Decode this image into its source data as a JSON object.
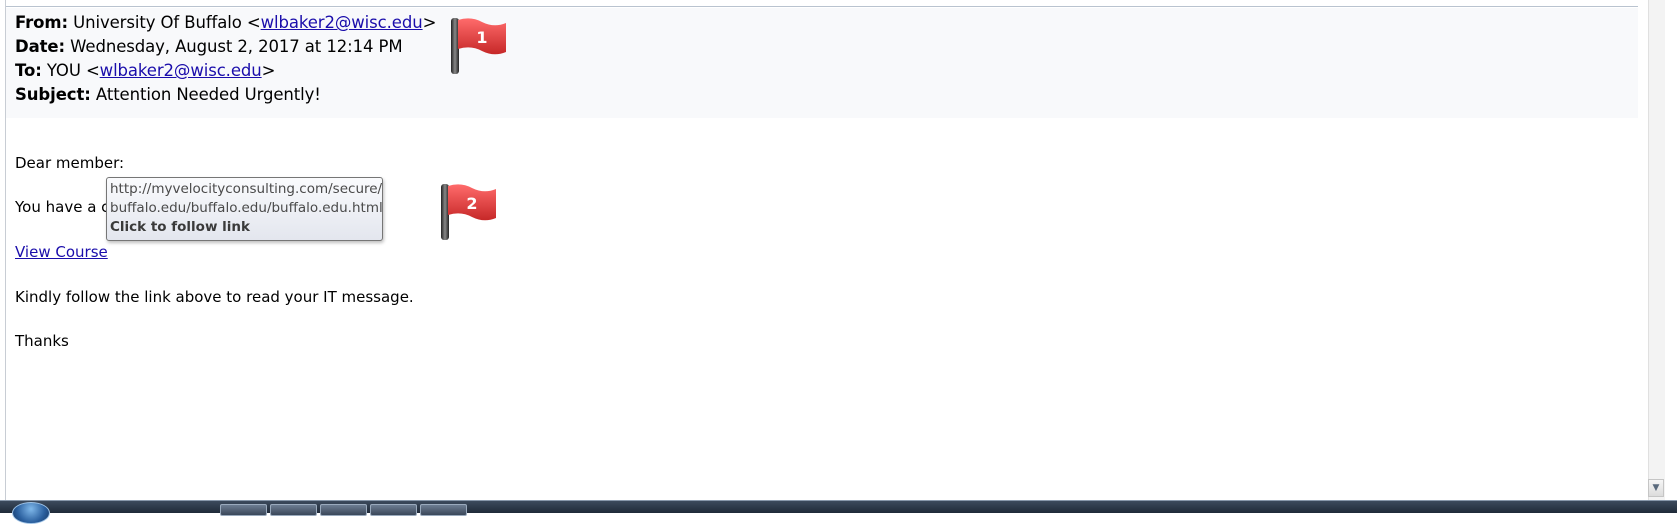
{
  "email": {
    "from_label": "From:",
    "from_name": "University Of Buffalo <",
    "from_email": "wlbaker2@wisc.edu",
    "from_close": ">",
    "date_label": "Date:",
    "date_value": "Wednesday, August 2, 2017 at 12:14 PM",
    "to_label": "To:",
    "to_name": "YOU <",
    "to_email": "wlbaker2@wisc.edu",
    "to_close": ">",
    "subject_label": "Subject:",
    "subject_value": "Attention Needed Urgently!"
  },
  "body": {
    "greeting": "Dear member:",
    "line1_visible": "You have a c",
    "link_text": "View Course",
    "instruction": "Kindly follow the link above to read your IT message.",
    "closing": "Thanks"
  },
  "tooltip": {
    "url_line1": "http://myvelocityconsulting.com/secure/",
    "url_line2": "buffalo.edu/buffalo.edu/buffalo.edu.html",
    "action": "Click to follow link"
  },
  "flags": {
    "flag1_number": "1",
    "flag2_number": "2",
    "color": "#e53935"
  },
  "scrollbar": {
    "down_arrow": "▼"
  }
}
